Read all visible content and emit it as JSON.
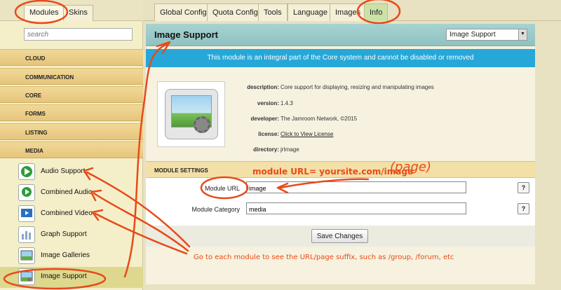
{
  "sidebar": {
    "tabs": [
      {
        "label": "Modules",
        "active": true
      },
      {
        "label": "Skins",
        "active": false
      }
    ],
    "search_placeholder": "search",
    "categories": [
      "CLOUD",
      "COMMUNICATION",
      "CORE",
      "FORMS",
      "LISTING",
      "MEDIA"
    ],
    "modules": [
      {
        "label": "Audio Support",
        "icon": "play-icon"
      },
      {
        "label": "Combined Audio",
        "icon": "play-icon"
      },
      {
        "label": "Combined Video",
        "icon": "video-icon"
      },
      {
        "label": "Graph Support",
        "icon": "graph-icon"
      },
      {
        "label": "Image Galleries",
        "icon": "gallery-icon"
      },
      {
        "label": "Image Support",
        "icon": "image-icon",
        "active": true
      }
    ]
  },
  "top_tabs": [
    {
      "label": "Global Config",
      "active": false
    },
    {
      "label": "Quota Config",
      "active": false
    },
    {
      "label": "Tools",
      "active": false
    },
    {
      "label": "Language",
      "active": false
    },
    {
      "label": "Images",
      "active": false
    },
    {
      "label": "Info",
      "active": true
    }
  ],
  "main": {
    "title": "Image Support",
    "module_select": "Image Support",
    "notice": "This module is an integral part of the Core system and cannot be disabled or removed",
    "info": [
      {
        "key": "description:",
        "value": "Core support for displaying, resizing and manipulating images"
      },
      {
        "key": "version:",
        "value": "1.4.3"
      },
      {
        "key": "developer:",
        "value": "The Jamroom Network, ©2015"
      },
      {
        "key": "license:",
        "value": "Click to View License"
      },
      {
        "key": "directory:",
        "value": "jrImage"
      }
    ],
    "settings_header": "MODULE SETTINGS",
    "fields": [
      {
        "label": "Module URL",
        "value": "image"
      },
      {
        "label": "Module Category",
        "value": "media"
      }
    ],
    "help_label": "?",
    "save_label": "Save Changes"
  },
  "annotations": {
    "url_note": "module URL= yoursite.com/image",
    "page_note": "(page)",
    "bottom_note": "Go to each module to see the URL/page suffix, such as /group, /forum, etc"
  },
  "colors": {
    "notice_bg": "#26a7d8",
    "title_bar": "#9ccbca",
    "annotation": "#e84a1a",
    "category_bg": "#ebcd85"
  }
}
